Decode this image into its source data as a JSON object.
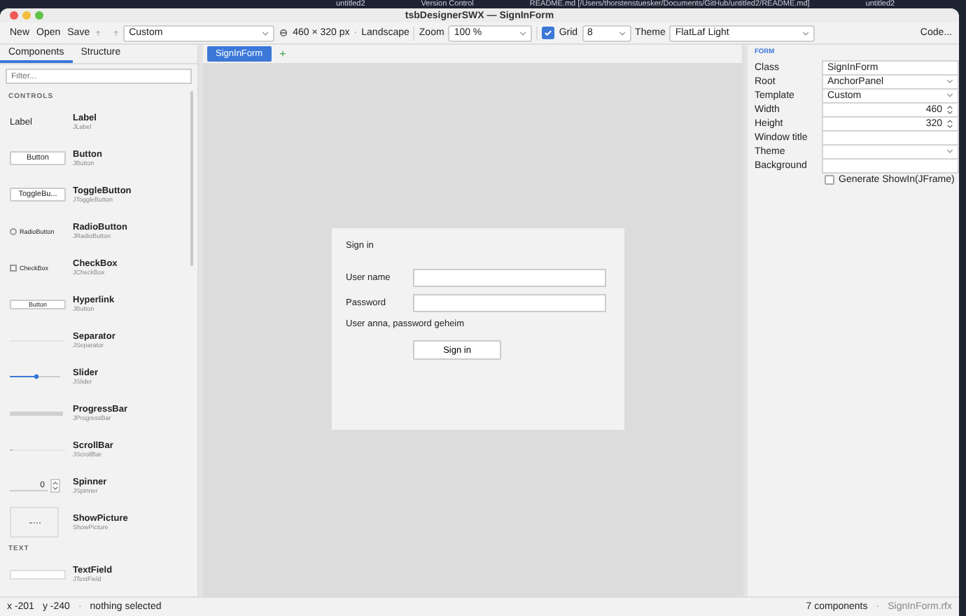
{
  "background_bar": {
    "items": [
      "untitled2",
      "Version Control",
      "README.md [/Users/thorstenstuesker/Documents/GitHub/untitled2/README.md]",
      "untitled2"
    ]
  },
  "window": {
    "title": "tsbDesignerSWX — SignInForm"
  },
  "toolbar": {
    "file_buttons": [
      "New",
      "Open",
      "Save"
    ],
    "undo": {
      "disabled": true
    },
    "redo": {
      "disabled": true
    },
    "size_preset": "Custom",
    "size": "460 × 320 px",
    "separator": "·",
    "orientation": "Landscape",
    "zoom_label": "Zoom",
    "zoom": "100 %",
    "grid": {
      "label": "Grid",
      "checked": true
    },
    "grid_size": "8",
    "theme_label": "Theme",
    "theme": "FlatLaf Light",
    "code_button": "Code..."
  },
  "left_tabs": [
    {
      "label": "Components",
      "selected": true
    },
    {
      "label": "Structure",
      "selected": false
    }
  ],
  "filter": {
    "placeholder": "Filter..."
  },
  "palette": [
    {
      "kind": "section",
      "title": "CONTROLS"
    },
    {
      "kind": "label",
      "preview": "Label",
      "name": "Label",
      "class": "JLabel"
    },
    {
      "kind": "button",
      "preview": "Button",
      "name": "Button",
      "class": "JButton"
    },
    {
      "kind": "button",
      "preview": "ToggleBu...",
      "name": "ToggleButton",
      "class": "JToggleButton"
    },
    {
      "kind": "radio",
      "preview": "RadioButton",
      "name": "RadioButton",
      "class": "JRadioButton"
    },
    {
      "kind": "checkbox",
      "preview": "CheckBox",
      "name": "CheckBox",
      "class": "JCheckBox"
    },
    {
      "kind": "link",
      "preview": "Button",
      "name": "Hyperlink",
      "class": "JButton"
    },
    {
      "kind": "separator",
      "name": "Separator",
      "class": "JSeparator"
    },
    {
      "kind": "slider",
      "name": "Slider",
      "class": "JSlider"
    },
    {
      "kind": "progress",
      "name": "ProgressBar",
      "class": "JProgressBar"
    },
    {
      "kind": "scrollbar",
      "name": "ScrollBar",
      "class": "JScrollBar"
    },
    {
      "kind": "spinner",
      "preview": "0",
      "name": "Spinner",
      "class": "JSpinner"
    },
    {
      "kind": "picture",
      "name": "ShowPicture",
      "class": "ShowPicture"
    },
    {
      "kind": "section",
      "title": "TEXT"
    },
    {
      "kind": "textfield",
      "name": "TextField",
      "class": "JTextField"
    }
  ],
  "form_tabs": [
    {
      "label": "SignInForm",
      "selected": true
    }
  ],
  "add_tab": "+",
  "form": {
    "title": "Sign in",
    "fields": [
      {
        "label": "User name"
      },
      {
        "label": "Password"
      }
    ],
    "hint": "User anna, password geheim",
    "button": "Sign in"
  },
  "properties": {
    "section": "FORM",
    "rows": [
      {
        "kind": "text",
        "label": "Class",
        "value": "SignInForm"
      },
      {
        "kind": "combo",
        "label": "Root",
        "value": "AnchorPanel"
      },
      {
        "kind": "combo",
        "label": "Template",
        "value": "Custom"
      },
      {
        "kind": "spinner",
        "label": "Width",
        "value": "460"
      },
      {
        "kind": "spinner",
        "label": "Height",
        "value": "320"
      },
      {
        "kind": "text",
        "label": "Window title"
      },
      {
        "kind": "combo",
        "label": "Theme"
      },
      {
        "kind": "text",
        "label": "Background"
      }
    ],
    "generate": {
      "label": "Generate ShowIn(JFrame)",
      "checked": false
    }
  },
  "status_bar": {
    "x": "x -201",
    "y": "y -240",
    "separator": "·",
    "selection": "nothing selected",
    "count": "7 components",
    "separator_2": "·",
    "file": "SignInForm.rfx"
  }
}
